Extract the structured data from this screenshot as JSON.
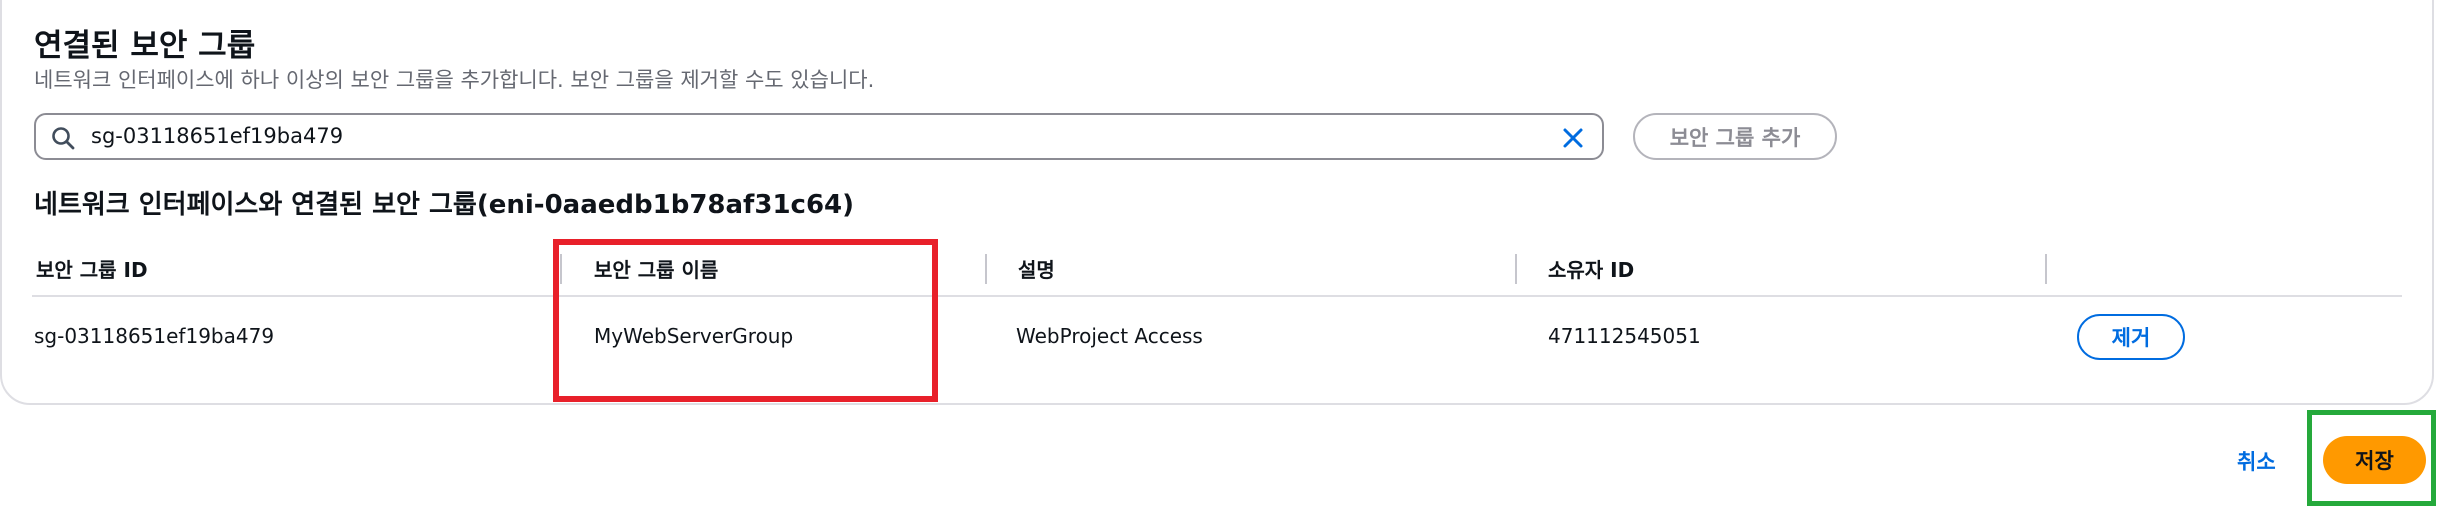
{
  "section": {
    "title": "연결된 보안 그룹",
    "description": "네트워크 인터페이스에 하나 이상의 보안 그룹을 추가합니다. 보안 그룹을 제거할 수도 있습니다."
  },
  "search": {
    "value": "sg-03118651ef19ba479",
    "icon": "search-icon",
    "clear_icon": "close-icon"
  },
  "add_button_label": "보안 그룹 추가",
  "table": {
    "title": "네트워크 인터페이스와 연결된 보안 그룹(eni-0aaedb1b78af31c64)",
    "columns": [
      "보안 그룹 ID",
      "보안 그룹 이름",
      "설명",
      "소유자 ID"
    ],
    "rows": [
      {
        "id": "sg-03118651ef19ba479",
        "name": "MyWebServerGroup",
        "description": "WebProject Access",
        "owner": "471112545051",
        "action_label": "제거"
      }
    ]
  },
  "footer": {
    "cancel_label": "취소",
    "save_label": "저장"
  },
  "colors": {
    "primary_link": "#006ce0",
    "save_button": "#ff9900",
    "highlight_red": "#e8202a",
    "highlight_green": "#25a93b"
  }
}
